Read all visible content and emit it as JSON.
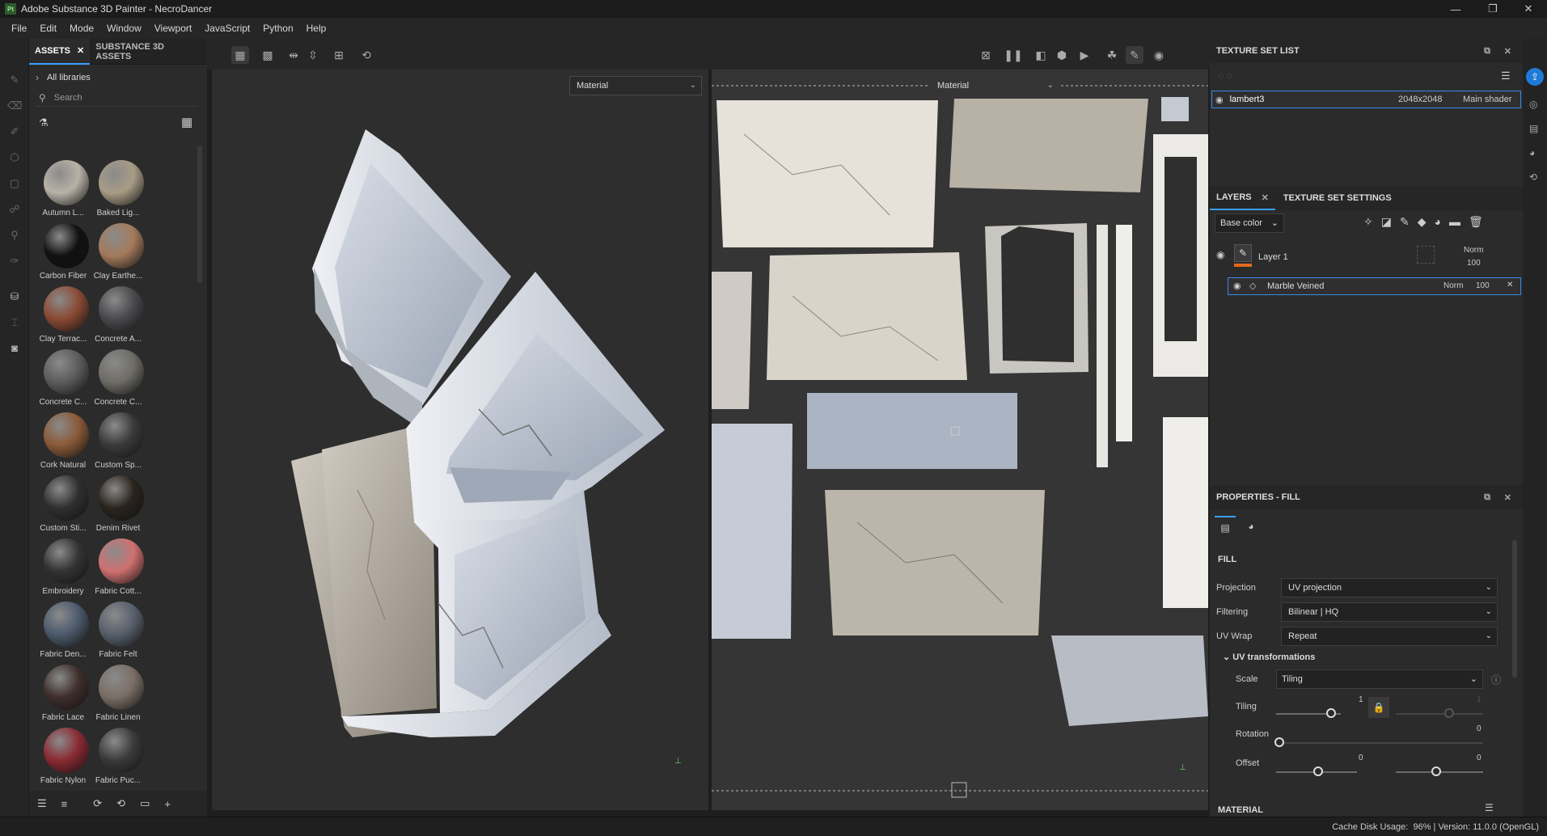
{
  "window": {
    "title": "Adobe Substance 3D Painter - NecroDancer",
    "logo": "Pt"
  },
  "menu": [
    "File",
    "Edit",
    "Mode",
    "Window",
    "Viewport",
    "JavaScript",
    "Python",
    "Help"
  ],
  "assets": {
    "tabs": [
      "ASSETS",
      "SUBSTANCE 3D ASSETS"
    ],
    "library": "All libraries",
    "search_placeholder": "Search",
    "items": [
      {
        "label": "Autumn L...",
        "color": "#b8b2a6"
      },
      {
        "label": "Baked Lig...",
        "color": "#a89c86"
      },
      {
        "label": "Carbon Fiber",
        "color": "#111111"
      },
      {
        "label": "Clay Earthe...",
        "color": "#a47a5c"
      },
      {
        "label": "Clay Terrac...",
        "color": "#8a4a34"
      },
      {
        "label": "Concrete A...",
        "color": "#4a4a4e"
      },
      {
        "label": "Concrete C...",
        "color": "#5c5c5c"
      },
      {
        "label": "Concrete C...",
        "color": "#6e6c66"
      },
      {
        "label": "Cork Natural",
        "color": "#8a5a38"
      },
      {
        "label": "Custom Sp...",
        "color": "#3a3a3a"
      },
      {
        "label": "Custom Sti...",
        "color": "#2f2f2f"
      },
      {
        "label": "Denim Rivet",
        "color": "#2a241e"
      },
      {
        "label": "Embroidery",
        "color": "#333333"
      },
      {
        "label": "Fabric Cott...",
        "color": "#d07070"
      },
      {
        "label": "Fabric Den...",
        "color": "#4c5a6c"
      },
      {
        "label": "Fabric Felt",
        "color": "#58606c"
      },
      {
        "label": "Fabric Lace",
        "color": "#3e2e2c"
      },
      {
        "label": "Fabric Linen",
        "color": "#7a6e66"
      },
      {
        "label": "Fabric Nylon",
        "color": "#8a2a32"
      },
      {
        "label": "Fabric Puc...",
        "color": "#3a3a3a"
      }
    ]
  },
  "viewport": {
    "left_mode": "Material",
    "right_mode": "Material"
  },
  "texture_set_list": {
    "title": "TEXTURE SET LIST",
    "row": {
      "name": "lambert3",
      "size": "2048x2048",
      "shader": "Main shader"
    }
  },
  "layers": {
    "tabs": [
      "LAYERS",
      "TEXTURE SET SETTINGS"
    ],
    "channel": "Base color",
    "layer1": {
      "name": "Layer 1",
      "blend": "Norm",
      "opacity": "100"
    },
    "fill": {
      "name": "Marble Veined",
      "blend": "Norm",
      "opacity": "100"
    }
  },
  "properties": {
    "title": "PROPERTIES - FILL",
    "section": "FILL",
    "projection_label": "Projection",
    "projection": "UV projection",
    "filtering_label": "Filtering",
    "filtering": "Bilinear | HQ",
    "uvwrap_label": "UV Wrap",
    "uvwrap": "Repeat",
    "uvtrans": "UV transformations",
    "scale_label": "Scale",
    "scale": "Tiling",
    "tiling_label": "Tiling",
    "tiling": "1",
    "tiling2": "1",
    "rotation_label": "Rotation",
    "rotation": "0",
    "offset_label": "Offset",
    "offset_u": "0",
    "offset_v": "0",
    "material_section": "MATERIAL"
  },
  "status": {
    "label": "Cache Disk Usage:",
    "value": "96% | Version: 11.0.0 (OpenGL)"
  },
  "colors": {
    "accent": "#3aa0ff",
    "orange": "#e06a1a"
  }
}
